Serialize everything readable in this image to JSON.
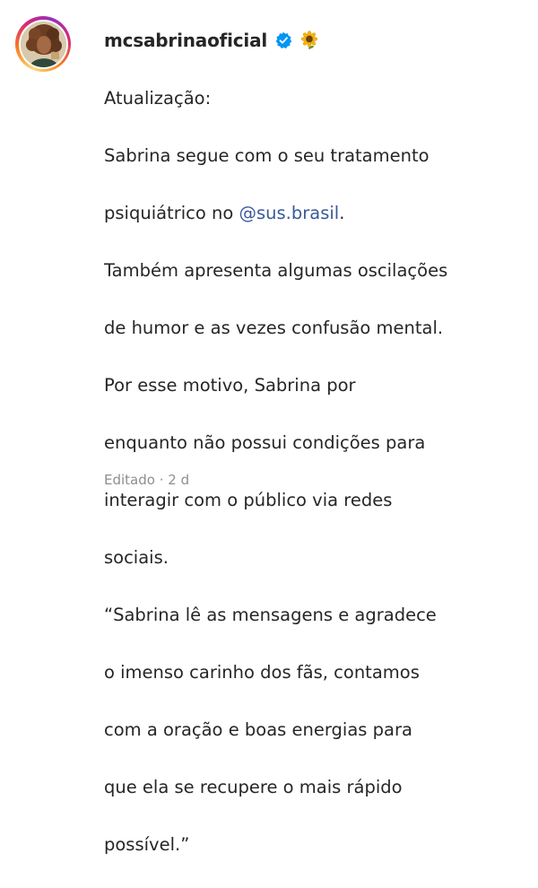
{
  "post": {
    "username": "mcsabrinaoficial",
    "verified_icon": "verified-badge-icon",
    "emoji_icon": "sunflower-icon",
    "caption_lines": [
      "Atualização:",
      "Sabrina segue com o seu tratamento",
      "psiquiátrico no ",
      "Também apresenta algumas oscilações",
      "de humor e as vezes confusão mental.",
      "Por esse motivo, Sabrina por",
      "enquanto não possui condições para",
      "interagir com o público via redes",
      "sociais.",
      "“Sabrina lê as mensagens e agradece",
      "o imenso carinho dos fãs, contamos",
      "com a oração e boas energias para",
      "que ela se recupere o mais rápido",
      "possível.”"
    ],
    "mention": "@sus.brasil",
    "mention_suffix": ".",
    "edited_label": "Editado",
    "separator": "·",
    "time_ago": "2 d"
  },
  "colors": {
    "text": "#262626",
    "muted": "#8e8e8e",
    "mention": "#3a5a99",
    "verified": "#0095f6"
  }
}
